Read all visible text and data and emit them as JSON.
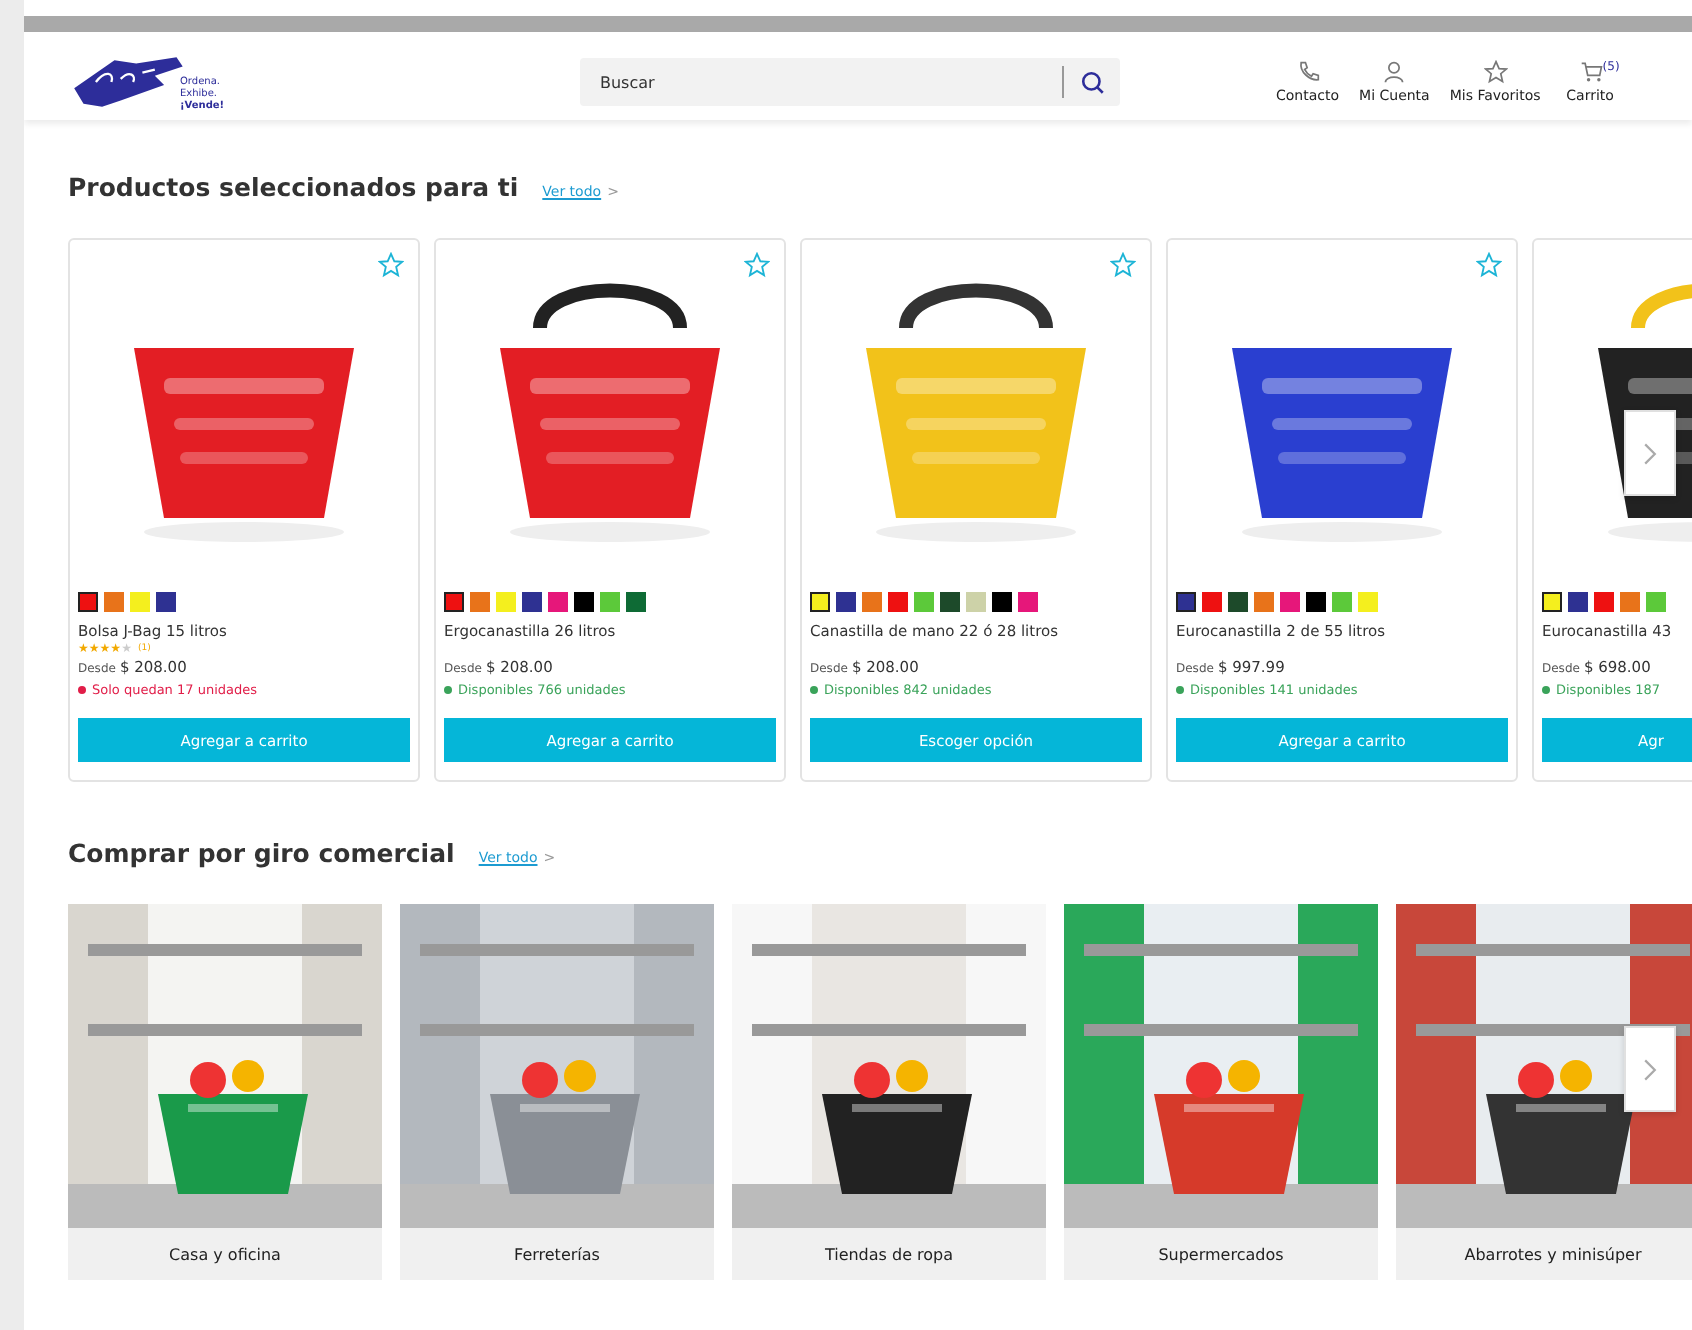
{
  "header": {
    "tagline": [
      "Ordena.",
      "Exhibe.",
      "¡Vende!"
    ],
    "search": {
      "placeholder": "Buscar"
    },
    "nav": [
      {
        "kind": "phone",
        "label": "Contacto"
      },
      {
        "kind": "user",
        "label": "Mi Cuenta"
      },
      {
        "kind": "star",
        "label": "Mis Favoritos"
      },
      {
        "kind": "cart",
        "label": "Carrito",
        "badge": "(5)"
      }
    ]
  },
  "products_section": {
    "title": "Productos seleccionados para ti",
    "link": "Ver todo",
    "link_arrow": ">",
    "products": [
      {
        "name": "Bolsa J-Bag 15 litros",
        "stars": 4,
        "reviews": "(1)",
        "price_prefix": "Desde",
        "price": "$ 208.00",
        "stock": "Solo quedan 17 unidades",
        "low_stock": true,
        "button": "Agregar a carrito",
        "swatches": [
          {
            "color": "#ee1111",
            "selected": true
          },
          {
            "color": "#e8731a",
            "selected": false
          },
          {
            "color": "#f4ef1e",
            "selected": false
          },
          {
            "color": "#2e3192",
            "selected": false
          }
        ]
      },
      {
        "name": "Ergocanastilla 26 litros",
        "price_prefix": "Desde",
        "price": "$ 208.00",
        "stock": "Disponibles 766 unidades",
        "low_stock": false,
        "button": "Agregar a carrito",
        "swatches": [
          {
            "color": "#ee1111",
            "selected": true
          },
          {
            "color": "#e8731a",
            "selected": false
          },
          {
            "color": "#f4ef1e",
            "selected": false
          },
          {
            "color": "#2e3192",
            "selected": false
          },
          {
            "color": "#e6177a",
            "selected": false
          },
          {
            "color": "#000000",
            "selected": false
          },
          {
            "color": "#5cc93a",
            "selected": false
          },
          {
            "color": "#0e6b35",
            "selected": false
          }
        ]
      },
      {
        "name": "Canastilla de mano 22 ó 28 litros",
        "price_prefix": "Desde",
        "price": "$ 208.00",
        "stock": "Disponibles 842 unidades",
        "low_stock": false,
        "button": "Escoger opción",
        "swatches": [
          {
            "color": "#f4ef1e",
            "selected": true
          },
          {
            "color": "#2e3192",
            "selected": false
          },
          {
            "color": "#e8731a",
            "selected": false
          },
          {
            "color": "#ee1111",
            "selected": false
          },
          {
            "color": "#5cc93a",
            "selected": false
          },
          {
            "color": "#1d4a2a",
            "selected": false
          },
          {
            "color": "#cdd2a8",
            "selected": false
          },
          {
            "color": "#000000",
            "selected": false
          },
          {
            "color": "#e6177a",
            "selected": false
          }
        ]
      },
      {
        "name": "Eurocanastilla 2 de 55 litros",
        "price_prefix": "Desde",
        "price": "$ 997.99",
        "stock": "Disponibles 141 unidades",
        "low_stock": false,
        "button": "Agregar a carrito",
        "swatches": [
          {
            "color": "#2e3192",
            "selected": true
          },
          {
            "color": "#ee1111",
            "selected": false
          },
          {
            "color": "#1d4a2a",
            "selected": false
          },
          {
            "color": "#e8731a",
            "selected": false
          },
          {
            "color": "#e6177a",
            "selected": false
          },
          {
            "color": "#000000",
            "selected": false
          },
          {
            "color": "#5cc93a",
            "selected": false
          },
          {
            "color": "#f4ef1e",
            "selected": false
          }
        ]
      },
      {
        "name": "Eurocanastilla 43",
        "price_prefix": "Desde",
        "price": "$ 698.00",
        "stock": "Disponibles 187",
        "low_stock": false,
        "button": "Agr",
        "swatches": [
          {
            "color": "#f4ef1e",
            "selected": true
          },
          {
            "color": "#2e3192",
            "selected": false
          },
          {
            "color": "#ee1111",
            "selected": false
          },
          {
            "color": "#e8731a",
            "selected": false
          },
          {
            "color": "#5cc93a",
            "selected": false
          }
        ]
      }
    ]
  },
  "categories_section": {
    "title": "Comprar por giro comercial",
    "link": "Ver todo",
    "link_arrow": ">",
    "categories": [
      {
        "label": "Casa y oficina"
      },
      {
        "label": "Ferreterías"
      },
      {
        "label": "Tiendas de ropa"
      },
      {
        "label": "Supermercados"
      },
      {
        "label": "Abarrotes y minisúper"
      }
    ]
  }
}
